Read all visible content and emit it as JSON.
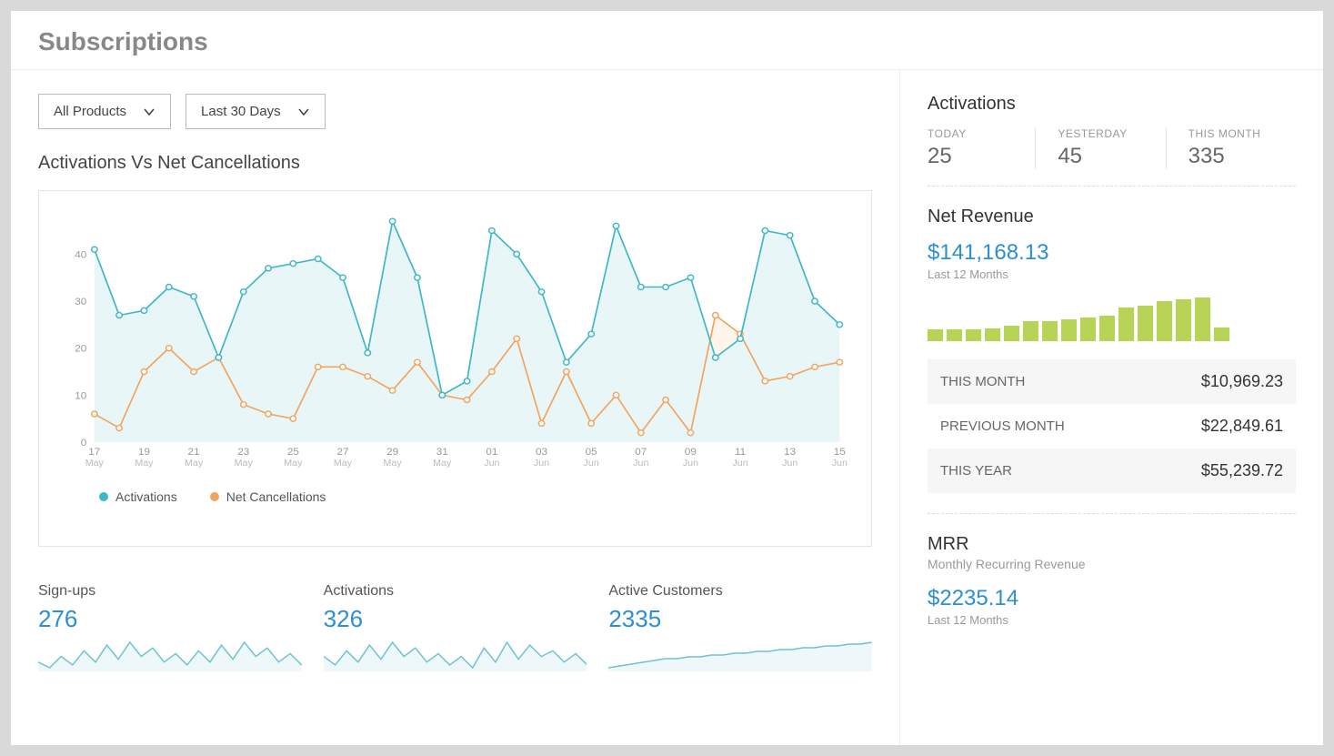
{
  "page_title": "Subscriptions",
  "filters": {
    "product": "All Products",
    "range": "Last 30 Days"
  },
  "chart_data": {
    "type": "line",
    "title": "Activations Vs Net Cancellations",
    "ylim": [
      0,
      48
    ],
    "yticks": [
      0,
      10,
      20,
      30,
      40
    ],
    "categories": [
      {
        "d": "17",
        "m": "May"
      },
      {
        "d": "19",
        "m": "May"
      },
      {
        "d": "21",
        "m": "May"
      },
      {
        "d": "23",
        "m": "May"
      },
      {
        "d": "25",
        "m": "May"
      },
      {
        "d": "27",
        "m": "May"
      },
      {
        "d": "29",
        "m": "May"
      },
      {
        "d": "31",
        "m": "May"
      },
      {
        "d": "01",
        "m": "Jun"
      },
      {
        "d": "03",
        "m": "Jun"
      },
      {
        "d": "05",
        "m": "Jun"
      },
      {
        "d": "07",
        "m": "Jun"
      },
      {
        "d": "09",
        "m": "Jun"
      },
      {
        "d": "11",
        "m": "Jun"
      },
      {
        "d": "13",
        "m": "Jun"
      },
      {
        "d": "15",
        "m": "Jun"
      }
    ],
    "series": [
      {
        "name": "Activations",
        "color": "#3fb7c6",
        "fill": "#e9f6f8",
        "values": [
          41,
          27,
          28,
          33,
          31,
          18,
          32,
          37,
          38,
          39,
          35,
          19,
          47,
          35,
          10,
          13,
          45,
          40,
          32,
          17,
          23,
          46,
          33,
          33,
          35,
          18,
          22,
          45,
          44,
          30,
          25
        ]
      },
      {
        "name": "Net Cancellations",
        "color": "#f2a45f",
        "fill": "#fdf5ea",
        "values": [
          6,
          3,
          15,
          20,
          15,
          18,
          8,
          6,
          5,
          16,
          16,
          14,
          11,
          17,
          10,
          9,
          15,
          22,
          4,
          15,
          4,
          10,
          2,
          9,
          2,
          27,
          23,
          13,
          14,
          16,
          17
        ]
      }
    ]
  },
  "legend": {
    "activations": "Activations",
    "cancellations": "Net Cancellations"
  },
  "mini_stats": [
    {
      "label": "Sign-ups",
      "value": "276",
      "spark": [
        20,
        18,
        22,
        19,
        24,
        20,
        26,
        21,
        27,
        22,
        25,
        20,
        23,
        19,
        24,
        20,
        26,
        21,
        27,
        22,
        25,
        20,
        23,
        19
      ]
    },
    {
      "label": "Activations",
      "value": "326",
      "spark": [
        22,
        19,
        24,
        20,
        26,
        21,
        27,
        22,
        25,
        20,
        23,
        19,
        22,
        18,
        25,
        20,
        27,
        21,
        26,
        22,
        24,
        20,
        23,
        19
      ]
    },
    {
      "label": "Active Customers",
      "value": "2335",
      "spark": [
        10,
        11,
        12,
        13,
        14,
        15,
        15,
        16,
        16,
        17,
        17,
        18,
        18,
        19,
        19,
        20,
        20,
        21,
        21,
        22,
        22,
        23,
        23,
        24
      ]
    }
  ],
  "activations_panel": {
    "title": "Activations",
    "cards": [
      {
        "label": "TODAY",
        "value": "25"
      },
      {
        "label": "YESTERDAY",
        "value": "45"
      },
      {
        "label": "THIS MONTH",
        "value": "335"
      }
    ]
  },
  "net_revenue": {
    "title": "Net Revenue",
    "amount": "$141,168.13",
    "period": "Last 12 Months",
    "bars": [
      12,
      12,
      12,
      13,
      16,
      20,
      20,
      22,
      24,
      26,
      34,
      36,
      40,
      42,
      44,
      14
    ],
    "rows": [
      {
        "label": "THIS MONTH",
        "amount": "$10,969.23"
      },
      {
        "label": "PREVIOUS MONTH",
        "amount": "$22,849.61"
      },
      {
        "label": "THIS YEAR",
        "amount": "$55,239.72"
      }
    ]
  },
  "mrr": {
    "title": "MRR",
    "subtitle": "Monthly Recurring Revenue",
    "amount": "$2235.14",
    "period": "Last 12 Months"
  }
}
